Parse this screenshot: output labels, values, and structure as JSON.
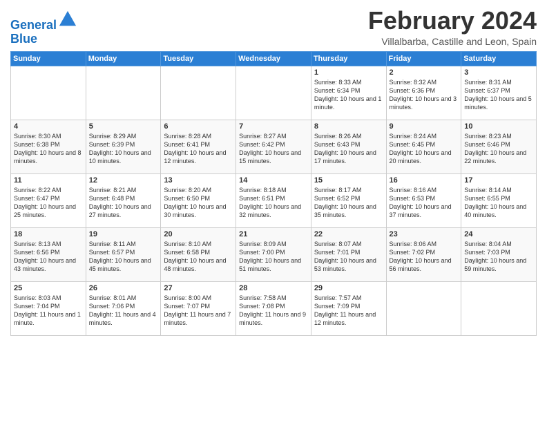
{
  "header": {
    "logo_line1": "General",
    "logo_line2": "Blue",
    "month": "February 2024",
    "location": "Villalbarba, Castille and Leon, Spain"
  },
  "weekdays": [
    "Sunday",
    "Monday",
    "Tuesday",
    "Wednesday",
    "Thursday",
    "Friday",
    "Saturday"
  ],
  "weeks": [
    [
      {
        "day": "",
        "info": ""
      },
      {
        "day": "",
        "info": ""
      },
      {
        "day": "",
        "info": ""
      },
      {
        "day": "",
        "info": ""
      },
      {
        "day": "1",
        "info": "Sunrise: 8:33 AM\nSunset: 6:34 PM\nDaylight: 10 hours and 1 minute."
      },
      {
        "day": "2",
        "info": "Sunrise: 8:32 AM\nSunset: 6:36 PM\nDaylight: 10 hours and 3 minutes."
      },
      {
        "day": "3",
        "info": "Sunrise: 8:31 AM\nSunset: 6:37 PM\nDaylight: 10 hours and 5 minutes."
      }
    ],
    [
      {
        "day": "4",
        "info": "Sunrise: 8:30 AM\nSunset: 6:38 PM\nDaylight: 10 hours and 8 minutes."
      },
      {
        "day": "5",
        "info": "Sunrise: 8:29 AM\nSunset: 6:39 PM\nDaylight: 10 hours and 10 minutes."
      },
      {
        "day": "6",
        "info": "Sunrise: 8:28 AM\nSunset: 6:41 PM\nDaylight: 10 hours and 12 minutes."
      },
      {
        "day": "7",
        "info": "Sunrise: 8:27 AM\nSunset: 6:42 PM\nDaylight: 10 hours and 15 minutes."
      },
      {
        "day": "8",
        "info": "Sunrise: 8:26 AM\nSunset: 6:43 PM\nDaylight: 10 hours and 17 minutes."
      },
      {
        "day": "9",
        "info": "Sunrise: 8:24 AM\nSunset: 6:45 PM\nDaylight: 10 hours and 20 minutes."
      },
      {
        "day": "10",
        "info": "Sunrise: 8:23 AM\nSunset: 6:46 PM\nDaylight: 10 hours and 22 minutes."
      }
    ],
    [
      {
        "day": "11",
        "info": "Sunrise: 8:22 AM\nSunset: 6:47 PM\nDaylight: 10 hours and 25 minutes."
      },
      {
        "day": "12",
        "info": "Sunrise: 8:21 AM\nSunset: 6:48 PM\nDaylight: 10 hours and 27 minutes."
      },
      {
        "day": "13",
        "info": "Sunrise: 8:20 AM\nSunset: 6:50 PM\nDaylight: 10 hours and 30 minutes."
      },
      {
        "day": "14",
        "info": "Sunrise: 8:18 AM\nSunset: 6:51 PM\nDaylight: 10 hours and 32 minutes."
      },
      {
        "day": "15",
        "info": "Sunrise: 8:17 AM\nSunset: 6:52 PM\nDaylight: 10 hours and 35 minutes."
      },
      {
        "day": "16",
        "info": "Sunrise: 8:16 AM\nSunset: 6:53 PM\nDaylight: 10 hours and 37 minutes."
      },
      {
        "day": "17",
        "info": "Sunrise: 8:14 AM\nSunset: 6:55 PM\nDaylight: 10 hours and 40 minutes."
      }
    ],
    [
      {
        "day": "18",
        "info": "Sunrise: 8:13 AM\nSunset: 6:56 PM\nDaylight: 10 hours and 43 minutes."
      },
      {
        "day": "19",
        "info": "Sunrise: 8:11 AM\nSunset: 6:57 PM\nDaylight: 10 hours and 45 minutes."
      },
      {
        "day": "20",
        "info": "Sunrise: 8:10 AM\nSunset: 6:58 PM\nDaylight: 10 hours and 48 minutes."
      },
      {
        "day": "21",
        "info": "Sunrise: 8:09 AM\nSunset: 7:00 PM\nDaylight: 10 hours and 51 minutes."
      },
      {
        "day": "22",
        "info": "Sunrise: 8:07 AM\nSunset: 7:01 PM\nDaylight: 10 hours and 53 minutes."
      },
      {
        "day": "23",
        "info": "Sunrise: 8:06 AM\nSunset: 7:02 PM\nDaylight: 10 hours and 56 minutes."
      },
      {
        "day": "24",
        "info": "Sunrise: 8:04 AM\nSunset: 7:03 PM\nDaylight: 10 hours and 59 minutes."
      }
    ],
    [
      {
        "day": "25",
        "info": "Sunrise: 8:03 AM\nSunset: 7:04 PM\nDaylight: 11 hours and 1 minute."
      },
      {
        "day": "26",
        "info": "Sunrise: 8:01 AM\nSunset: 7:06 PM\nDaylight: 11 hours and 4 minutes."
      },
      {
        "day": "27",
        "info": "Sunrise: 8:00 AM\nSunset: 7:07 PM\nDaylight: 11 hours and 7 minutes."
      },
      {
        "day": "28",
        "info": "Sunrise: 7:58 AM\nSunset: 7:08 PM\nDaylight: 11 hours and 9 minutes."
      },
      {
        "day": "29",
        "info": "Sunrise: 7:57 AM\nSunset: 7:09 PM\nDaylight: 11 hours and 12 minutes."
      },
      {
        "day": "",
        "info": ""
      },
      {
        "day": "",
        "info": ""
      }
    ]
  ]
}
